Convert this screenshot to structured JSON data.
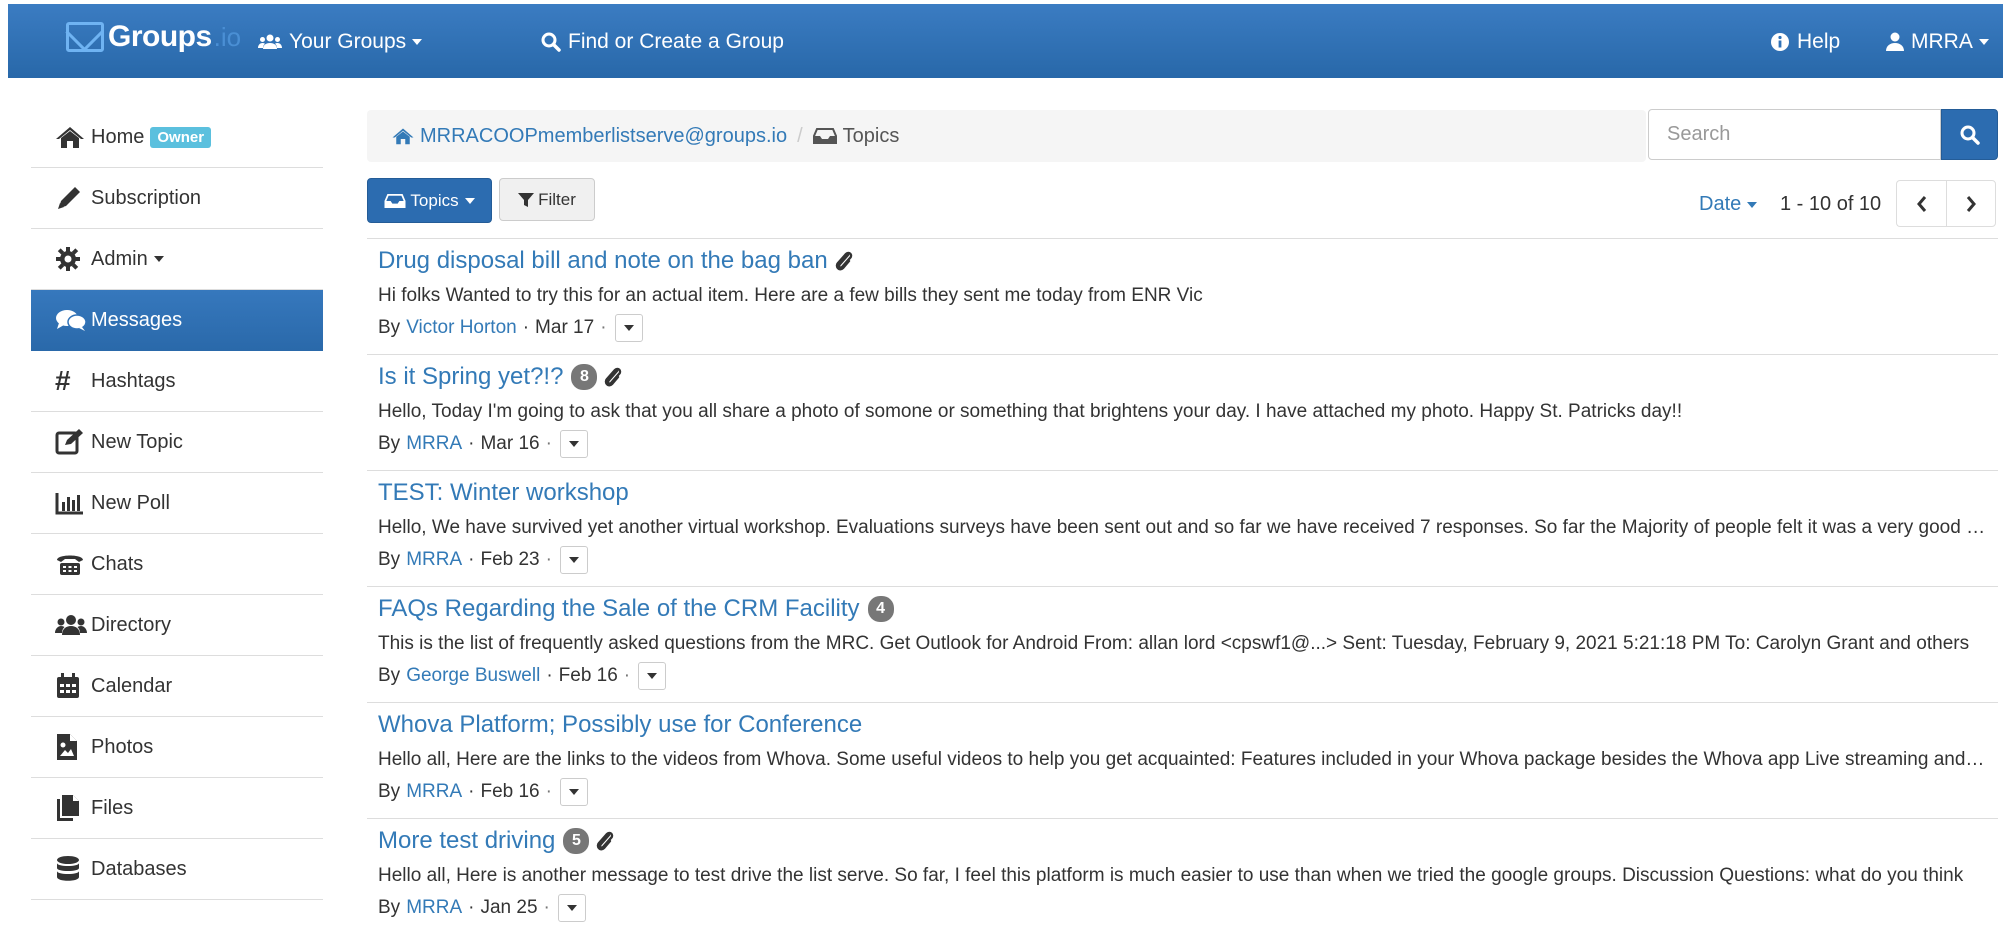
{
  "navbar": {
    "brand": "Groups",
    "brand_suffix": ".io",
    "your_groups": "Your Groups",
    "find_create": "Find or Create a Group",
    "help": "Help",
    "user": "MRRA"
  },
  "sidebar": {
    "items": [
      {
        "label": "Home",
        "icon": "home-icon",
        "badge": "Owner"
      },
      {
        "label": "Subscription",
        "icon": "pencil-icon"
      },
      {
        "label": "Admin",
        "icon": "gear-icon"
      },
      {
        "label": "Messages",
        "icon": "comments-icon"
      },
      {
        "label": "Hashtags",
        "icon": "hashtag-icon"
      },
      {
        "label": "New Topic",
        "icon": "edit-icon"
      },
      {
        "label": "New Poll",
        "icon": "bar-chart-icon"
      },
      {
        "label": "Chats",
        "icon": "phone-icon"
      },
      {
        "label": "Directory",
        "icon": "users-icon"
      },
      {
        "label": "Calendar",
        "icon": "calendar-icon"
      },
      {
        "label": "Photos",
        "icon": "photo-file-icon"
      },
      {
        "label": "Files",
        "icon": "files-icon"
      },
      {
        "label": "Databases",
        "icon": "database-icon"
      }
    ]
  },
  "breadcrumb": {
    "group": "MRRACOOPmemberlistserve@groups.io",
    "current": "Topics"
  },
  "search": {
    "placeholder": "Search"
  },
  "toolbar": {
    "topics_label": "Topics",
    "filter_label": "Filter",
    "sort_label": "Date",
    "page_count": "1 - 10 of 10"
  },
  "topics": [
    {
      "title": "Drug disposal bill and note on the bag ban",
      "count": "",
      "attachment": true,
      "snippet": "Hi folks Wanted to try this for an actual item. Here are a few bills they sent me today from ENR Vic",
      "by": "By",
      "author": "Victor Horton",
      "date": "Mar 17"
    },
    {
      "title": "Is it Spring yet?!?",
      "count": "8",
      "attachment": true,
      "snippet": "Hello, Today I'm going to ask that you all share a photo of somone or something that brightens your day. I have attached my photo. Happy St. Patricks day!!",
      "by": "By",
      "author": "MRRA",
      "date": "Mar 16"
    },
    {
      "title": "TEST: Winter workshop",
      "count": "",
      "attachment": false,
      "snippet": "Hello, We have survived yet another virtual workshop. Evaluations surveys have been sent out and so far we have received 7 responses. So far the Majority of people felt it was a very good workshop and enjoyed the presentations.",
      "by": "By",
      "author": "MRRA",
      "date": "Feb 23"
    },
    {
      "title": "FAQs Regarding the Sale of the CRM Facility",
      "count": "4",
      "attachment": false,
      "snippet": "This is the list of frequently asked questions from the MRC. Get Outlook for Android From: allan lord <cpswf1@...> Sent: Tuesday, February 9, 2021 5:21:18 PM To: Carolyn Grant and others",
      "by": "By",
      "author": "George Buswell",
      "date": "Feb 16"
    },
    {
      "title": "Whova Platform; Possibly use for Conference",
      "count": "",
      "attachment": false,
      "snippet": "Hello all, Here are the links to the videos from Whova. Some useful videos to help you get acquainted: Features included in your Whova package besides the Whova app Live streaming and more",
      "by": "By",
      "author": "MRRA",
      "date": "Feb 16"
    },
    {
      "title": "More test driving",
      "count": "5",
      "attachment": true,
      "snippet": "Hello all, Here is another message to test drive the list serve. So far, I feel this platform is much easier to use than when we tried the google groups. Discussion Questions: what do you think",
      "by": "By",
      "author": "MRRA",
      "date": "Jan 25"
    }
  ],
  "colors": {
    "navbar": "#2f72b8",
    "link": "#337ab7",
    "active": "#2c6cb0",
    "owner_badge": "#5bc0de",
    "count_badge": "#777777"
  }
}
